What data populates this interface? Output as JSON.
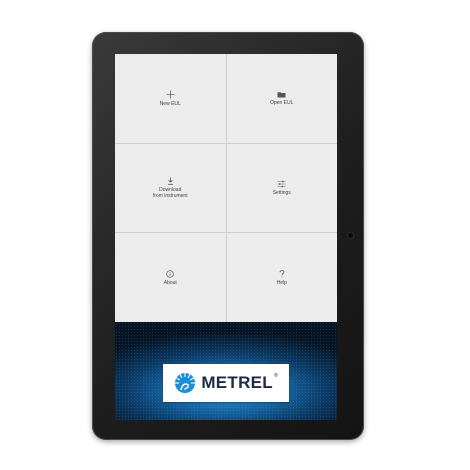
{
  "menu": {
    "tiles": [
      {
        "label": "New EUL",
        "icon": "plus-icon"
      },
      {
        "label": "Open EUL",
        "icon": "folder-icon"
      },
      {
        "label": "Download\nfrom instrument",
        "icon": "download-icon"
      },
      {
        "label": "Settings",
        "icon": "sliders-icon"
      },
      {
        "label": "About",
        "icon": "info-icon"
      },
      {
        "label": "Help",
        "icon": "question-icon"
      }
    ]
  },
  "branding": {
    "name": "METREL",
    "registered": "®"
  },
  "colors": {
    "tile_background": "#ececec",
    "brand_blue": "#1466a6",
    "logo_text": "#1f2a44",
    "bezel": "#1e1e1e"
  }
}
